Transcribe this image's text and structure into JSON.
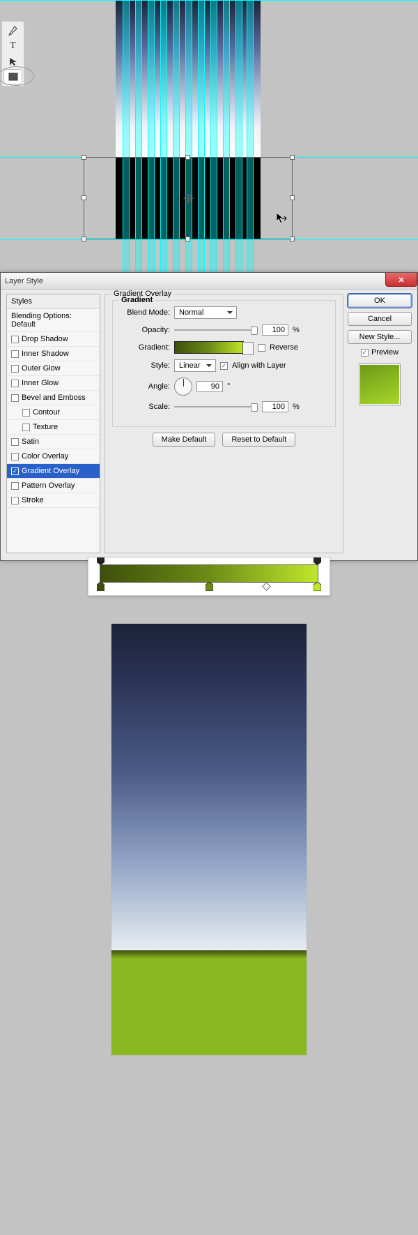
{
  "tools": [
    "pen-icon",
    "type-icon",
    "path-select-icon",
    "rectangle-icon"
  ],
  "dialog": {
    "title": "Layer Style",
    "close": "✕",
    "sidebar": {
      "head": "Styles",
      "items": [
        {
          "label": "Blending Options: Default",
          "check": false,
          "nochk": true
        },
        {
          "label": "Drop Shadow",
          "check": false
        },
        {
          "label": "Inner Shadow",
          "check": false
        },
        {
          "label": "Outer Glow",
          "check": false
        },
        {
          "label": "Inner Glow",
          "check": false
        },
        {
          "label": "Bevel and Emboss",
          "check": false
        },
        {
          "label": "Contour",
          "check": false,
          "sub": true
        },
        {
          "label": "Texture",
          "check": false,
          "sub": true
        },
        {
          "label": "Satin",
          "check": false
        },
        {
          "label": "Color Overlay",
          "check": false
        },
        {
          "label": "Gradient Overlay",
          "check": true,
          "selected": true
        },
        {
          "label": "Pattern Overlay",
          "check": false
        },
        {
          "label": "Stroke",
          "check": false
        }
      ]
    },
    "group_title": "Gradient Overlay",
    "subgroup_title": "Gradient",
    "blend_mode_label": "Blend Mode:",
    "blend_mode_value": "Normal",
    "opacity_label": "Opacity:",
    "opacity_value": "100",
    "pct": "%",
    "gradient_label": "Gradient:",
    "reverse_label": "Reverse",
    "reverse_checked": false,
    "style_label": "Style:",
    "style_value": "Linear",
    "align_label": "Align with Layer",
    "align_checked": true,
    "angle_label": "Angle:",
    "angle_value": "90",
    "angle_unit": "°",
    "scale_label": "Scale:",
    "scale_value": "100",
    "make_default": "Make Default",
    "reset_default": "Reset to Default",
    "ok": "OK",
    "cancel": "Cancel",
    "new_style": "New Style...",
    "preview_label": "Preview",
    "preview_checked": true
  },
  "editor": {
    "stops": [
      {
        "pos": 0,
        "color": "#3f4f0a"
      },
      {
        "pos": 50,
        "color": "#6c8b16"
      },
      {
        "pos": 100,
        "color": "#c0e72b"
      }
    ],
    "midpoint": 75
  }
}
